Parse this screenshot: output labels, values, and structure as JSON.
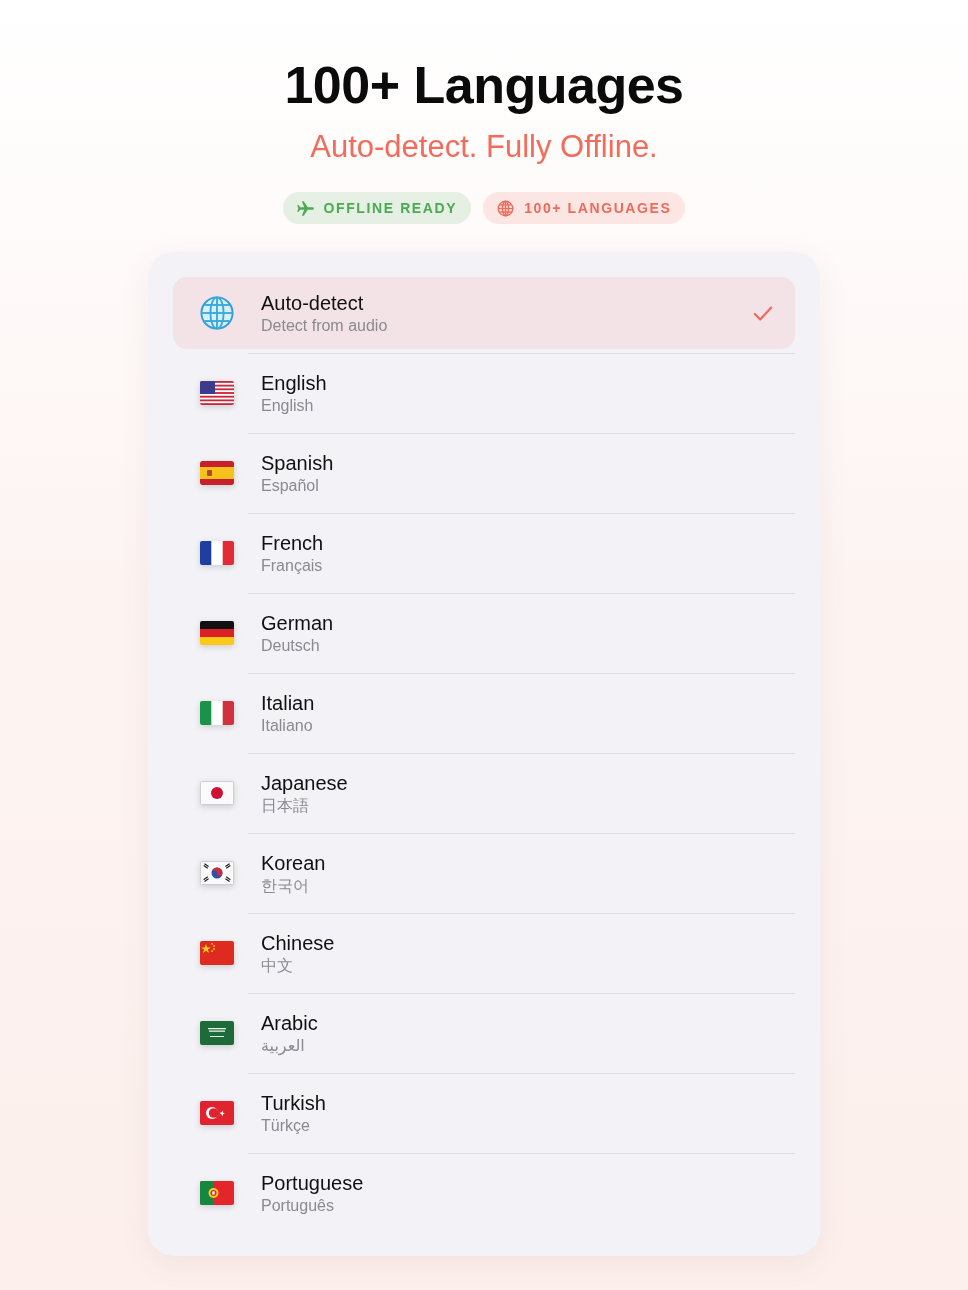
{
  "header": {
    "title": "100+ Languages",
    "subtitle": "Auto-detect. Fully Offline."
  },
  "badges": [
    {
      "kind": "plane",
      "label": "OFFLINE READY",
      "color": "#4caa55"
    },
    {
      "kind": "globe",
      "label": "100+ LANGUAGES",
      "color": "#ef6a5a"
    }
  ],
  "languages": [
    {
      "kind": "globe",
      "name": "Auto-detect",
      "native": "Detect from audio",
      "selected": true
    },
    {
      "kind": "us",
      "name": "English",
      "native": "English",
      "selected": false
    },
    {
      "kind": "spain",
      "name": "Spanish",
      "native": "Español",
      "selected": false
    },
    {
      "kind": "france",
      "name": "French",
      "native": "Français",
      "selected": false
    },
    {
      "kind": "germany",
      "name": "German",
      "native": "Deutsch",
      "selected": false
    },
    {
      "kind": "italy",
      "name": "Italian",
      "native": "Italiano",
      "selected": false
    },
    {
      "kind": "japan",
      "name": "Japanese",
      "native": "日本語",
      "selected": false
    },
    {
      "kind": "korea",
      "name": "Korean",
      "native": "한국어",
      "selected": false
    },
    {
      "kind": "china",
      "name": "Chinese",
      "native": "中文",
      "selected": false
    },
    {
      "kind": "saudi",
      "name": "Arabic",
      "native": "العربية",
      "selected": false
    },
    {
      "kind": "turkey",
      "name": "Turkish",
      "native": "Türkçe",
      "selected": false
    },
    {
      "kind": "portugal",
      "name": "Portuguese",
      "native": "Português",
      "selected": false
    }
  ]
}
